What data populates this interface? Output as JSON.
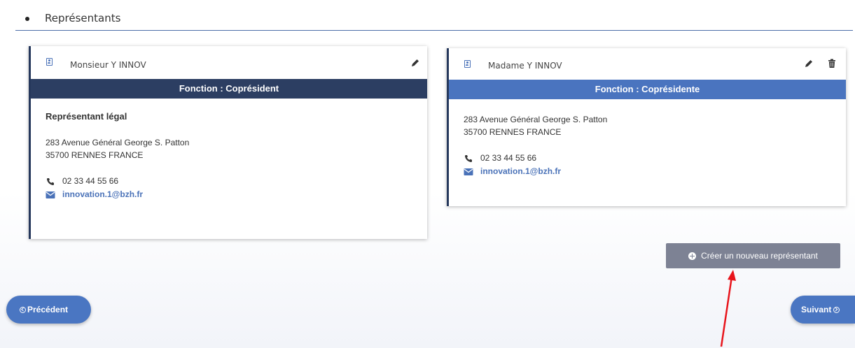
{
  "section": {
    "title": "Représentants"
  },
  "representatives": [
    {
      "name": "Monsieur Y INNOV",
      "fonction": "Fonction : Coprésident",
      "role": "Représentant légal",
      "address_line1": "283 Avenue Général George S. Patton",
      "address_line2": "35700 RENNES FRANCE",
      "phone": "02 33 44 55 66",
      "email": "innovation.1@bzh.fr"
    },
    {
      "name": "Madame Y INNOV",
      "fonction": "Fonction : Coprésidente",
      "address_line1": "283 Avenue Général George S. Patton",
      "address_line2": "35700 RENNES FRANCE",
      "phone": "02 33 44 55 66",
      "email": "innovation.1@bzh.fr"
    }
  ],
  "actions": {
    "create_label": "Créer un nouveau représentant",
    "prev_label": "Précédent",
    "next_label": "Suivant"
  },
  "icons": [
    "person-card-icon",
    "pencil-icon",
    "trash-icon",
    "phone-icon",
    "envelope-icon",
    "plus-circle-icon",
    "chevron-left-circle-icon",
    "chevron-right-circle-icon"
  ],
  "colors": {
    "header_rule": "#4d6ea8",
    "fonction_dark": "#2c3e62",
    "fonction_blue": "#4a74bf",
    "link_blue": "#4a72b8",
    "button_grey": "#7d8294",
    "nav_blue": "#4a76c2",
    "annotation_red": "#e8141b"
  }
}
